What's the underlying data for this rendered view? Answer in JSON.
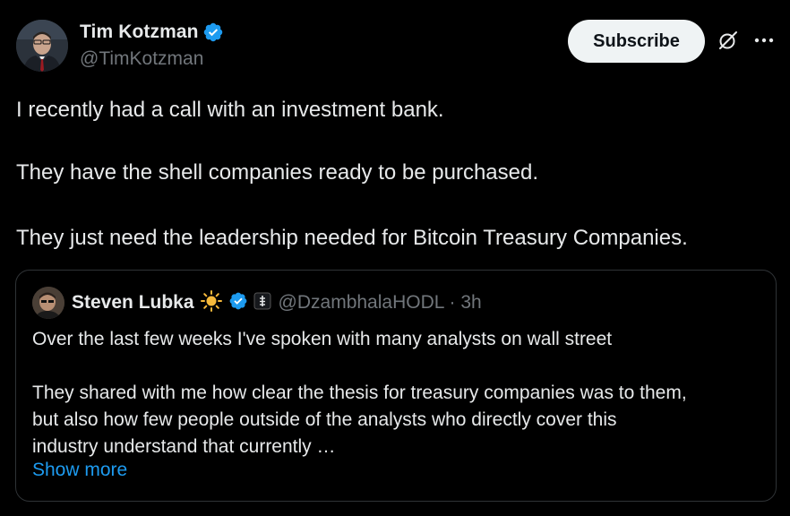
{
  "author": {
    "display_name": "Tim Kotzman",
    "handle": "@TimKotzman",
    "verified": true
  },
  "actions": {
    "subscribe_label": "Subscribe",
    "grok_icon": "grok-icon",
    "more_icon": "more-icon"
  },
  "post": {
    "line1": "I recently had a call with an investment bank.",
    "line2": "They have the shell companies ready to be purchased.",
    "line3": "They just need the leadership needed for Bitcoin Treasury Companies."
  },
  "quote": {
    "display_name": "Steven Lubka",
    "handle_time": "@DzambhalaHODL · 3h",
    "verified": true,
    "line1": "Over the last few weeks I've spoken with many analysts on wall street",
    "line2": "They shared with me how clear the thesis for treasury companies was to them,",
    "line3": "but also how few people outside of the analysts who directly cover this",
    "line4": "industry understand that currently …",
    "show_more": "Show more"
  },
  "colors": {
    "background": "#000000",
    "text": "#e7e9ea",
    "secondary": "#71767b",
    "link": "#1d9bf0",
    "verified": "#1d9bf0",
    "border": "#2f3336"
  }
}
